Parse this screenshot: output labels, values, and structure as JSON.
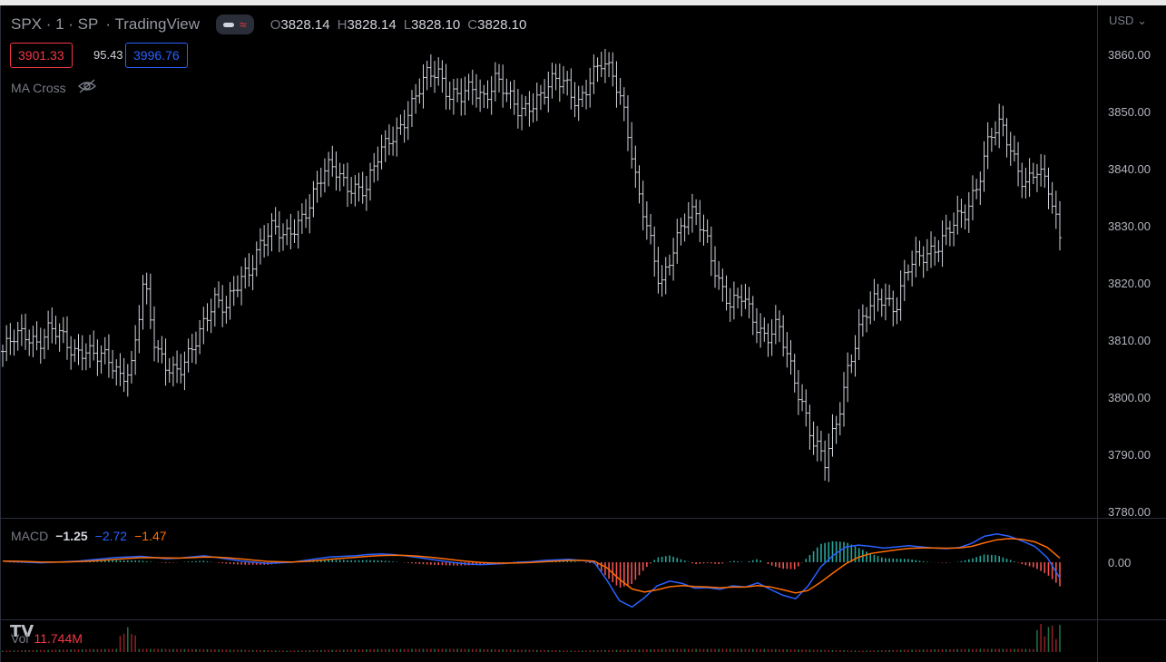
{
  "header": {
    "title": "SPX · 1 · SP",
    "source": "· TradingView",
    "ohlc": {
      "o_label": "O",
      "o": "3828.14",
      "h_label": "H",
      "h": "3828.14",
      "l_label": "L",
      "l": "3828.10",
      "c_label": "C",
      "c": "3828.10"
    }
  },
  "price_boxes": {
    "sell": "3901.33",
    "spread": "95.43",
    "buy": "3996.76"
  },
  "indicator": {
    "name": "MA Cross"
  },
  "axis": {
    "currency": "USD",
    "ticks": [
      "3860.00",
      "3850.00",
      "3840.00",
      "3830.00",
      "3820.00",
      "3810.00",
      "3800.00",
      "3790.00",
      "3780.00"
    ],
    "macd_zero": "0.00"
  },
  "macd": {
    "name": "MACD",
    "macd": "−1.25",
    "signal": "−2.72",
    "hist": "−1.47"
  },
  "volume": {
    "name": "Vol",
    "value": "11.744M"
  },
  "colors": {
    "macd_line": "#2962ff",
    "signal_line": "#ff6d00",
    "hist_up": "#26a69a",
    "hist_down": "#ef5350",
    "bars": "#d1d4dc"
  },
  "chart_data": {
    "type": "ohlc",
    "ylim": [
      3780,
      3860
    ],
    "close_series": [
      3808,
      3810,
      3811,
      3810,
      3812,
      3810,
      3808,
      3809,
      3807,
      3806,
      3804,
      3806,
      3820,
      3808,
      3806,
      3805,
      3807,
      3812,
      3818,
      3816,
      3819,
      3822,
      3828,
      3830,
      3827,
      3830,
      3834,
      3838,
      3840,
      3838,
      3837,
      3836,
      3842,
      3846,
      3848,
      3851,
      3856,
      3858,
      3853,
      3852,
      3854,
      3853,
      3856,
      3852,
      3850,
      3852,
      3853,
      3855,
      3855,
      3852,
      3855,
      3858,
      3857,
      3850,
      3836,
      3828,
      3820,
      3826,
      3830,
      3832,
      3828,
      3820,
      3815,
      3818,
      3814,
      3810,
      3812,
      3806,
      3800,
      3792,
      3788,
      3796,
      3806,
      3812,
      3816,
      3818,
      3816,
      3822,
      3824,
      3826,
      3828,
      3830,
      3832,
      3838,
      3846,
      3847,
      3842,
      3838,
      3840,
      3836,
      3828
    ],
    "macd_series": [
      0.2,
      0.1,
      0.0,
      -0.1,
      0.0,
      0.1,
      0.2,
      0.4,
      0.6,
      0.8,
      0.9,
      1.0,
      0.8,
      0.6,
      0.7,
      0.9,
      1.1,
      0.8,
      0.5,
      0.2,
      0.0,
      -0.2,
      -0.1,
      0.0,
      0.3,
      0.6,
      0.9,
      1.0,
      1.1,
      1.3,
      1.4,
      1.3,
      1.1,
      0.8,
      0.5,
      0.2,
      -0.1,
      -0.3,
      -0.4,
      -0.3,
      -0.2,
      0.0,
      0.1,
      0.3,
      0.4,
      0.5,
      0.3,
      0.0,
      -3.0,
      -6.5,
      -7.6,
      -6.0,
      -4.0,
      -3.2,
      -3.6,
      -4.4,
      -4.3,
      -4.6,
      -4.0,
      -4.2,
      -3.5,
      -4.6,
      -5.6,
      -6.2,
      -4.0,
      -0.8,
      1.2,
      2.6,
      2.9,
      2.7,
      2.4,
      2.6,
      2.8,
      2.6,
      2.4,
      2.3,
      2.5,
      3.2,
      4.4,
      4.8,
      4.4,
      3.6,
      2.7,
      0.8,
      -2.7
    ]
  }
}
